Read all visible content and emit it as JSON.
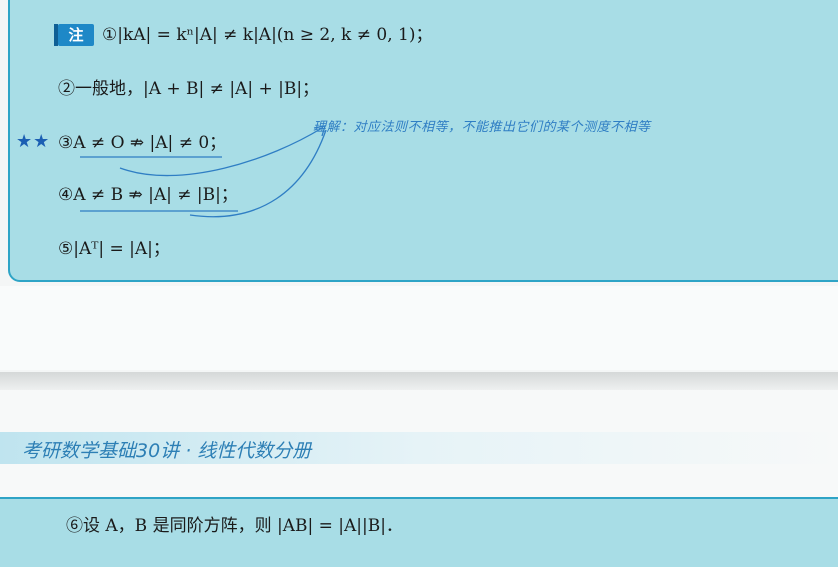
{
  "note_box": {
    "badge": "注",
    "stars": "★★",
    "items": [
      "①|kA| = kⁿ|A| ≠ k|A|(n ≥ 2, k ≠ 0, 1)；",
      "②一般地，|A + B| ≠ |A| + |B|；",
      "③A ≠ O ⇏ |A| ≠ 0；",
      "④A ≠ B ⇏ |A| ≠ |B|；",
      "⑤|Aᵀ| = |A|；"
    ],
    "annotation": "理解：对应法则不相等，不能推出它们的某个测度不相等"
  },
  "page_header": "考研数学基础30讲 · 线性代数分册",
  "bottom_item": "⑥设 A，B 是同阶方阵，则 |AB| = |A||B|．",
  "colors": {
    "box_fill": "#a8dde6",
    "box_border": "#2ea4c6",
    "badge": "#1e88c7",
    "annotation_ink": "#2f7ec4",
    "header_text": "#2d7fb5"
  }
}
